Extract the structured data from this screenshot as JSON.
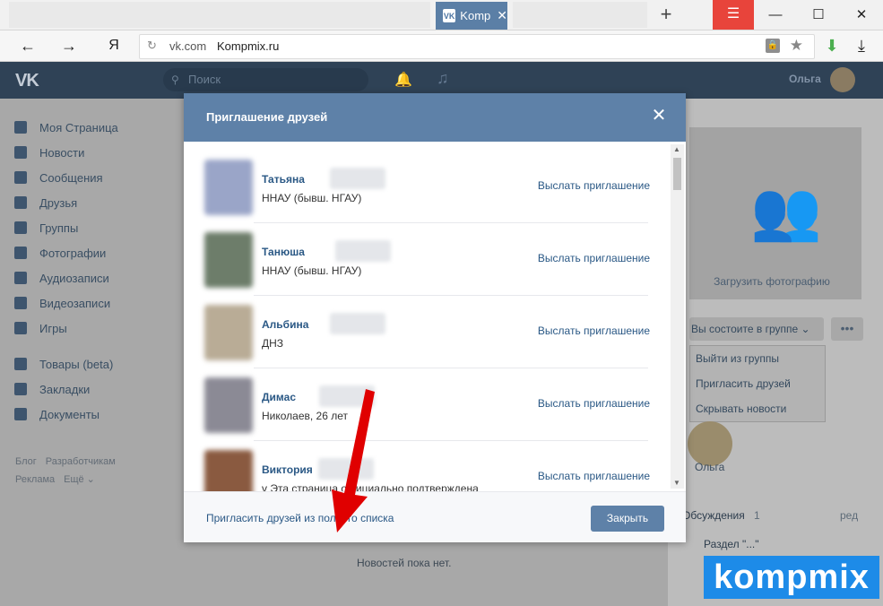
{
  "browser": {
    "active_tab": {
      "label": "Komp"
    },
    "new_tab_icon": "plus-icon",
    "menu_icon": "hamburger-icon",
    "window_controls": [
      "minimize",
      "maximize",
      "close"
    ],
    "address": {
      "domain": "vk.com",
      "title": "Kompmix.ru"
    },
    "nav": {
      "back": "←",
      "forward": "→",
      "ya": "Я"
    }
  },
  "vk_header": {
    "logo": "VK",
    "search_placeholder": "Поиск",
    "user_name": "Ольга"
  },
  "sidebar": {
    "items": [
      {
        "label": "Моя Страница",
        "icon": "user-icon"
      },
      {
        "label": "Новости",
        "icon": "news-icon"
      },
      {
        "label": "Сообщения",
        "icon": "message-icon"
      },
      {
        "label": "Друзья",
        "icon": "friends-icon"
      },
      {
        "label": "Группы",
        "icon": "groups-icon"
      },
      {
        "label": "Фотографии",
        "icon": "camera-icon"
      },
      {
        "label": "Аудиозаписи",
        "icon": "music-icon"
      },
      {
        "label": "Видеозаписи",
        "icon": "video-icon"
      },
      {
        "label": "Игры",
        "icon": "game-icon"
      }
    ],
    "items2": [
      {
        "label": "Товары (beta)",
        "icon": "bag-icon"
      },
      {
        "label": "Закладки",
        "icon": "star-icon"
      },
      {
        "label": "Документы",
        "icon": "document-icon"
      }
    ],
    "footer": {
      "blog": "Блог",
      "dev": "Разработчикам",
      "ads": "Реклама",
      "more": "Ещё ⌄"
    }
  },
  "right_col": {
    "upload_photo": "Загрузить фотографию",
    "group_state": "Вы состоите в группе ⌄",
    "more": "•••",
    "menu": [
      "Выйти из группы",
      "Пригласить друзей",
      "Скрывать новости"
    ],
    "member_name": "Ольга",
    "discussions": "Обсуждения",
    "discussions_count": "1",
    "discussions_edit": "ред",
    "section": "Раздел \"...\""
  },
  "feed": {
    "empty": "Новостей пока нет."
  },
  "modal": {
    "title": "Приглашение друзей",
    "close_icon": "close-icon",
    "invite_label": "Выслать приглашение",
    "friends": [
      {
        "name": "Татьяна",
        "info": "ННАУ (бывш. НГАУ)",
        "color": "#9aa5c8"
      },
      {
        "name": "Танюша",
        "info": "ННАУ (бывш. НГАУ)",
        "color": "#6d7d6a"
      },
      {
        "name": "Альбина",
        "info": "ДНЗ",
        "color": "#b9ac96"
      },
      {
        "name": "Димас",
        "info": "Николаев, 26 лет",
        "color": "#8b8a95"
      },
      {
        "name": "Виктория",
        "info": "v Эта страница официально подтверждена",
        "color": "#8a5a40"
      }
    ],
    "full_list_link": "Пригласить друзей из полного списка",
    "close_button": "Закрыть"
  },
  "watermark": {
    "text": "kompmix",
    "color": "#1d8be8"
  }
}
